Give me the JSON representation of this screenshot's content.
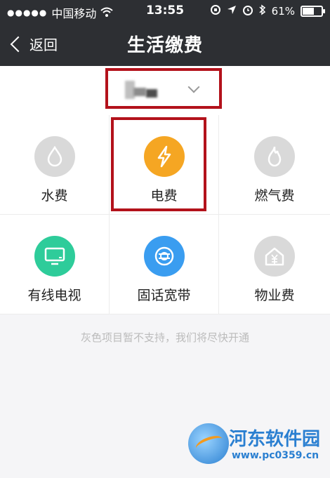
{
  "status_bar": {
    "signal": "●●●●●",
    "carrier": "中国移动",
    "time": "13:55",
    "battery_percent": "61%",
    "battery_level": 0.61
  },
  "nav": {
    "back_label": "返回",
    "title": "生活缴费"
  },
  "services": [
    {
      "label": "水费",
      "icon": "water-drop-icon",
      "color": "#d9d9d9",
      "enabled": false
    },
    {
      "label": "电费",
      "icon": "lightning-icon",
      "color": "#f5a623",
      "enabled": true
    },
    {
      "label": "燃气费",
      "icon": "flame-icon",
      "color": "#d9d9d9",
      "enabled": false
    },
    {
      "label": "有线电视",
      "icon": "tv-icon",
      "color": "#2ecc9a",
      "enabled": true
    },
    {
      "label": "固话宽带",
      "icon": "broadband-icon",
      "color": "#3a9df0",
      "enabled": true
    },
    {
      "label": "物业费",
      "icon": "house-yuan-icon",
      "color": "#d9d9d9",
      "enabled": false
    }
  ],
  "notice": "灰色项目暂不支持，我们将尽快开通",
  "watermark": {
    "title": "河东软件园",
    "url": "www.pc0359.cn"
  },
  "colors": {
    "navbar": "#2d2f33",
    "highlight": "#b3121b"
  }
}
